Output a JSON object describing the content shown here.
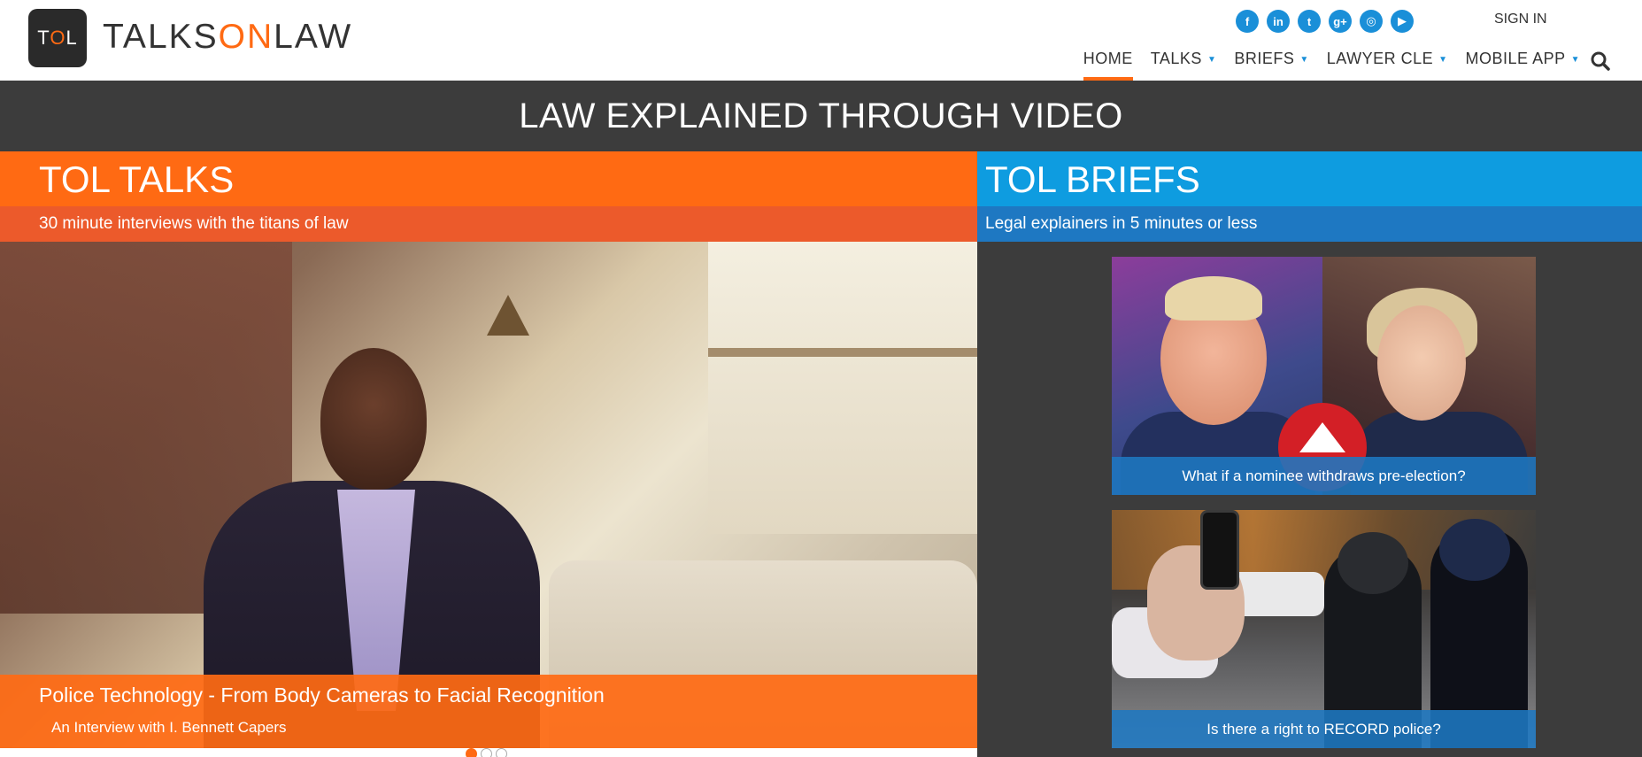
{
  "brand": {
    "logo_text": "TOL",
    "wordmark_pre": "TALKS",
    "wordmark_on": "ON",
    "wordmark_post": "LAW"
  },
  "header": {
    "social": [
      {
        "icon": "facebook-icon",
        "glyph": "f"
      },
      {
        "icon": "linkedin-icon",
        "glyph": "in"
      },
      {
        "icon": "twitter-icon",
        "glyph": "t"
      },
      {
        "icon": "google-plus-icon",
        "glyph": "g+"
      },
      {
        "icon": "instagram-icon",
        "glyph": "◎"
      },
      {
        "icon": "youtube-icon",
        "glyph": "▶"
      }
    ],
    "sign_in": "SIGN IN",
    "nav": [
      {
        "label": "HOME",
        "active": true,
        "dropdown": false
      },
      {
        "label": "TALKS",
        "active": false,
        "dropdown": true
      },
      {
        "label": "BRIEFS",
        "active": false,
        "dropdown": true
      },
      {
        "label": "LAWYER CLE",
        "active": false,
        "dropdown": true
      },
      {
        "label": "MOBILE APP",
        "active": false,
        "dropdown": true
      }
    ],
    "accent_color": "#ff6a13",
    "social_color": "#1a8fd8"
  },
  "banner": {
    "title": "LAW EXPLAINED THROUGH VIDEO"
  },
  "talks": {
    "title": "TOL TALKS",
    "subtitle": "30 minute interviews with the titans of law",
    "feature": {
      "title": "Police Technology - From Body Cameras to Facial Recognition",
      "subtitle": "An Interview with I. Bennett Capers"
    },
    "slides": 3,
    "active_slide": 1
  },
  "briefs": {
    "title": "TOL BRIEFS",
    "subtitle": "Legal explainers in 5 minutes or less",
    "cards": [
      {
        "caption": "What if a nominee withdraws pre-election?"
      },
      {
        "caption": "Is there a right to RECORD police?"
      }
    ]
  }
}
